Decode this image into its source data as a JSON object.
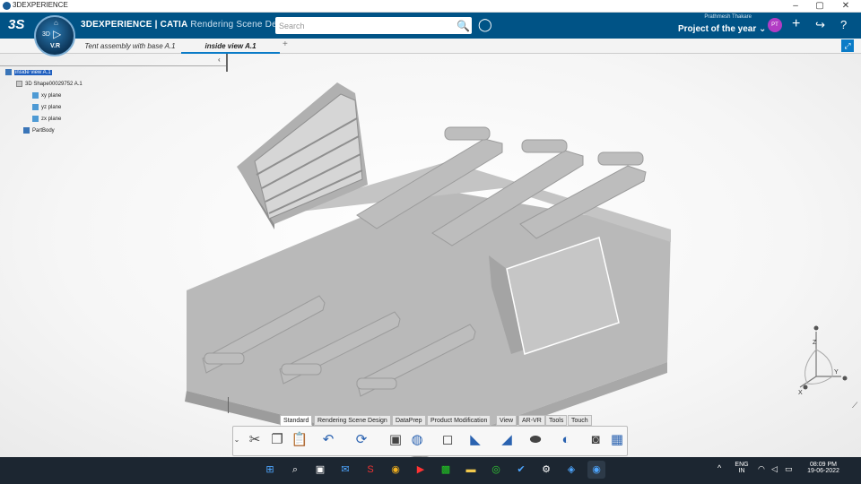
{
  "window": {
    "title": "3DEXPERIENCE",
    "minimize": "–",
    "maximize": "▢",
    "close": "✕"
  },
  "app": {
    "brand_main": "3DEXPERIENCE | CATIA",
    "brand_sub": "Rendering Scene Design",
    "compass_label": "3D",
    "compass_version": "V.R",
    "logo": "3S",
    "search_placeholder": "Search",
    "user_name": "Prathmesh Thakare",
    "project": "Project of the year",
    "avatar_initials": "PT",
    "accent_color": "#005386"
  },
  "tabs": [
    {
      "label": "Tent assembly with base A.1",
      "active": false
    },
    {
      "label": "inside view A.1",
      "active": true
    }
  ],
  "tree": [
    {
      "label": "inside view A.1",
      "selected": true,
      "level": 0
    },
    {
      "label": "3D Shape00029752 A.1",
      "selected": false,
      "level": 1
    },
    {
      "label": "xy plane",
      "selected": false,
      "level": 2
    },
    {
      "label": "yz plane",
      "selected": false,
      "level": 2
    },
    {
      "label": "zx plane",
      "selected": false,
      "level": 2
    },
    {
      "label": "PartBody",
      "selected": false,
      "level": 2
    }
  ],
  "workbench_tabs": [
    {
      "label": "Standard",
      "active": true
    },
    {
      "label": "Rendering Scene Design",
      "active": false
    },
    {
      "label": "DataPrep",
      "active": false
    },
    {
      "label": "Product Modification",
      "active": false
    },
    {
      "label": "View",
      "active": false
    },
    {
      "label": "AR-VR",
      "active": false
    },
    {
      "label": "Tools",
      "active": false
    },
    {
      "label": "Touch",
      "active": false
    }
  ],
  "axes": {
    "z": "Z",
    "x": "X",
    "y": "Y"
  },
  "taskbar": {
    "lang_1": "ENG",
    "lang_2": "IN",
    "time": "08:09 PM",
    "date": "19-06-2022"
  }
}
